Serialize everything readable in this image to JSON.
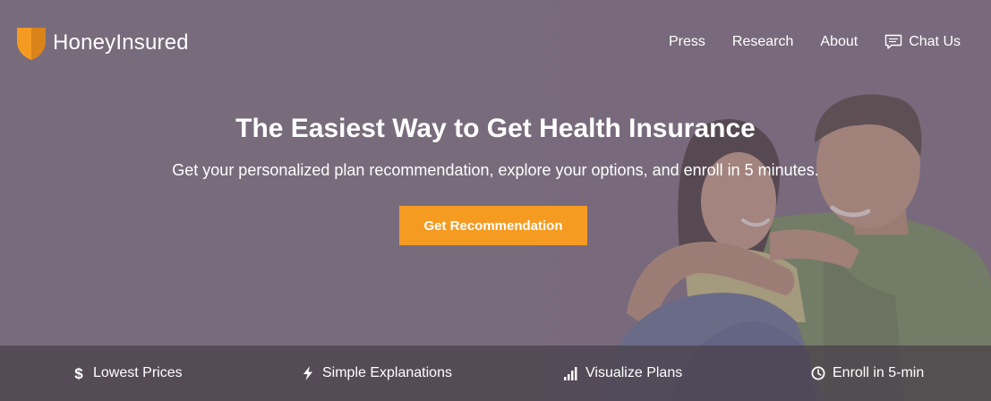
{
  "brand": {
    "name": "HoneyInsured",
    "accent_color": "#f59b22",
    "logo_icon": "shield-icon"
  },
  "nav": {
    "items": [
      {
        "label": "Press"
      },
      {
        "label": "Research"
      },
      {
        "label": "About"
      },
      {
        "label": "Chat Us",
        "icon": "chat-icon"
      }
    ]
  },
  "hero": {
    "headline": "The Easiest Way to Get Health Insurance",
    "subheadline": "Get your personalized plan recommendation, explore your options, and enroll in 5 minutes.",
    "cta_label": "Get Recommendation",
    "overlay_color": "#76697a"
  },
  "features": [
    {
      "label": "Lowest Prices",
      "icon": "dollar-icon"
    },
    {
      "label": "Simple Explanations",
      "icon": "lightning-icon"
    },
    {
      "label": "Visualize Plans",
      "icon": "bar-chart-icon"
    },
    {
      "label": "Enroll in 5-min",
      "icon": "clock-icon"
    }
  ]
}
